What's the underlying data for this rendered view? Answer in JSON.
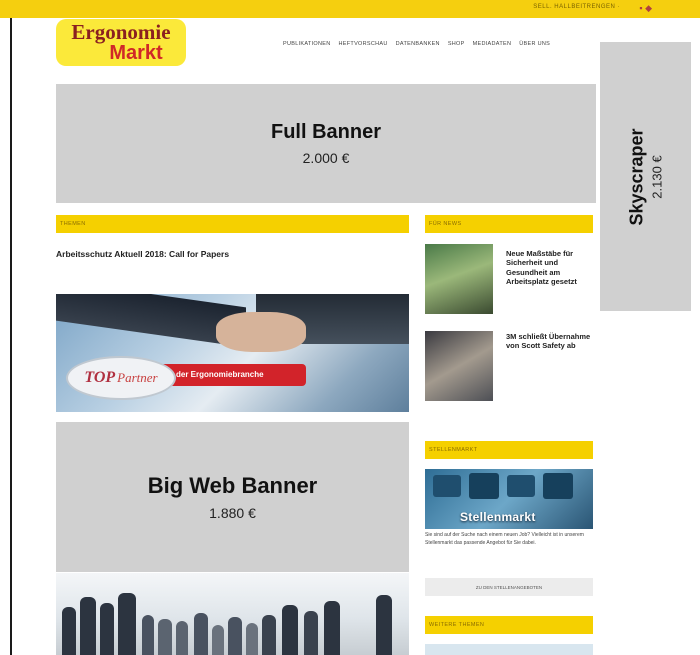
{
  "topbar": {
    "links": "SELL. HALLBEITRENGEN ·",
    "icons": "▪ ◆"
  },
  "logo": {
    "top": "Ergonomie",
    "bottom": "Markt"
  },
  "nav": [
    "PUBLIKATIONEN",
    "HEFTVORSCHAU",
    "DATENBANKEN",
    "SHOP",
    "MEDIADATEN",
    "ÜBER UNS"
  ],
  "banners": {
    "full": {
      "title": "Full Banner",
      "price": "2.000 €"
    },
    "skyscraper": {
      "title": "Skyscraper",
      "price": "2.130 €"
    },
    "big_web": {
      "title": "Big Web Banner",
      "price": "1.880 €"
    }
  },
  "sections": {
    "left_head": "THEMEN",
    "right_head": "FÜR NEWS",
    "stellen_head": "STELLENMARKT",
    "bottom_head": "WEITERE THEMEN"
  },
  "article": {
    "title": "Arbeitsschutz Aktuell 2018: Call for Papers"
  },
  "top_partner": {
    "badge": "TOP",
    "badge_sub": "Partner",
    "ribbon": "der Ergonomiebranche"
  },
  "news": [
    {
      "text": "Neue Maßstäbe für Sicherheit und Gesundheit am Arbeitsplatz gesetzt"
    },
    {
      "text": "3M schließt Übernahme von Scott Safety ab"
    }
  ],
  "stellenmarkt": {
    "image_text": "Stellenmarkt",
    "desc": "Sie sind auf der Suche nach einem neuen Job? Vielleicht ist in unserem Stellenmarkt das passende Angebot für Sie dabei.",
    "button": "ZU DEN STELLENANGEBOTEN"
  },
  "colors": {
    "accent": "#f5d000",
    "banner": "#d0d0d0"
  }
}
